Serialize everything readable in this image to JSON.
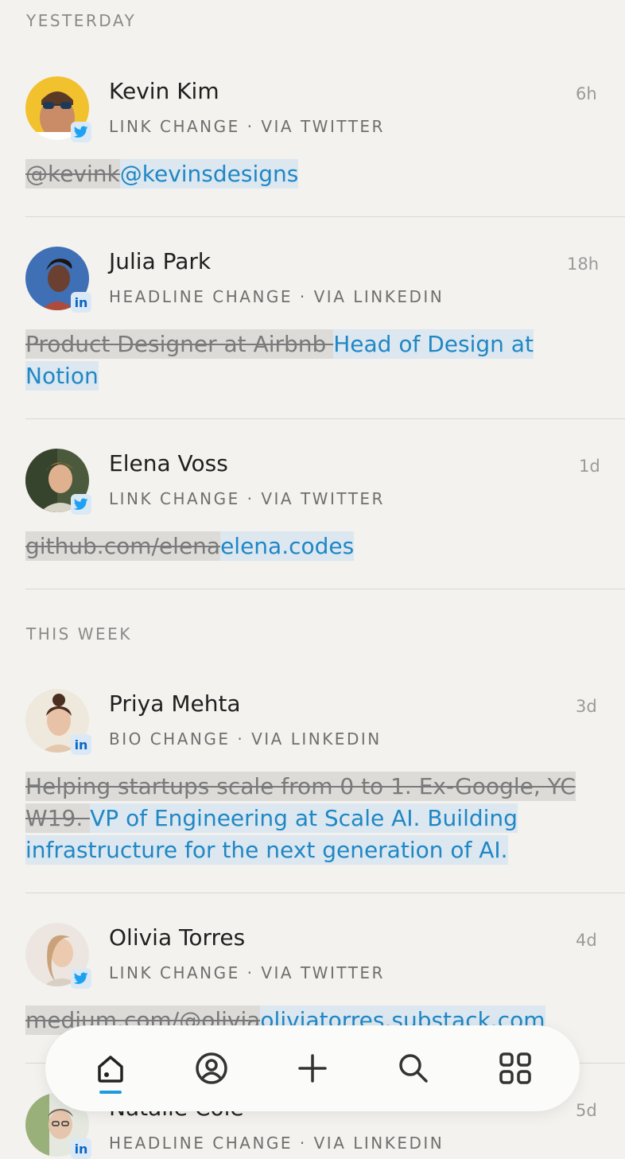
{
  "sections": {
    "yesterday": "YESTERDAY",
    "this_week": "THIS WEEK"
  },
  "entries": [
    {
      "name": "Kevin Kim",
      "meta": "LINK CHANGE · VIA TWITTER",
      "time": "6h",
      "source": "twitter",
      "old": "@kevink",
      "new": "@kevinsdesigns"
    },
    {
      "name": "Julia Park",
      "meta": "HEADLINE CHANGE · VIA LINKEDIN",
      "time": "18h",
      "source": "linkedin",
      "old": "Product Designer at Airbnb ",
      "new": "Head of Design at Notion"
    },
    {
      "name": "Elena Voss",
      "meta": "LINK CHANGE · VIA TWITTER",
      "time": "1d",
      "source": "twitter",
      "old": "github.com/elena",
      "new": "elena.codes"
    },
    {
      "name": "Priya Mehta",
      "meta": "BIO CHANGE · VIA LINKEDIN",
      "time": "3d",
      "source": "linkedin",
      "old": "Helping startups scale from 0 to 1. Ex-Google, YC W19. ",
      "new": "VP of Engineering at Scale AI. Building infrastructure for the next generation of AI."
    },
    {
      "name": "Olivia Torres",
      "meta": "LINK CHANGE · VIA TWITTER",
      "time": "4d",
      "source": "twitter",
      "old": "medium.com/@olivia",
      "new": "oliviatorres.substack.com"
    },
    {
      "name": "Natalie Cole",
      "meta": "HEADLINE CHANGE · VIA LINKEDIN",
      "time": "5d",
      "source": "linkedin",
      "old": "",
      "new": ""
    }
  ],
  "badges": {
    "linkedin": "in"
  },
  "colors": {
    "accent": "#1f87c4",
    "old_bg": "#dcdbd8",
    "new_bg": "#dce7f0",
    "twitter": "#1da1f2",
    "linkedin": "#0a66c2"
  },
  "nav": {
    "items": [
      "home-icon",
      "profile-icon",
      "add-icon",
      "search-icon",
      "grid-icon"
    ],
    "active": "home-icon"
  }
}
